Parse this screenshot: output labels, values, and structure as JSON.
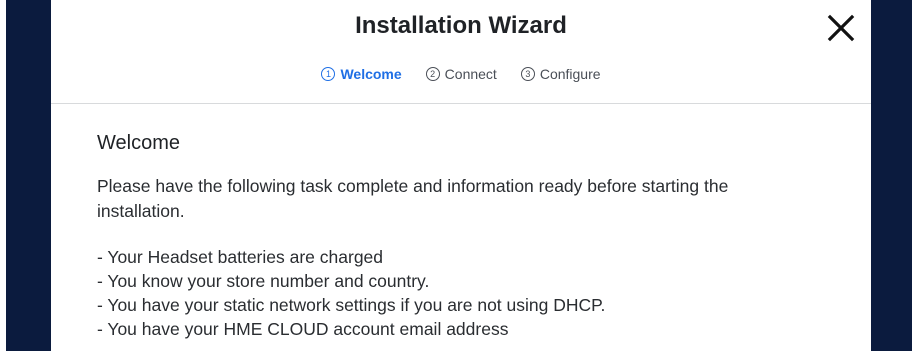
{
  "wizard": {
    "title": "Installation Wizard",
    "close_icon": "close-icon",
    "steps": [
      {
        "number": "1",
        "label": "Welcome",
        "active": true
      },
      {
        "number": "2",
        "label": "Connect",
        "active": false
      },
      {
        "number": "3",
        "label": "Configure",
        "active": false
      }
    ]
  },
  "content": {
    "heading": "Welcome",
    "intro": "Please have the following task complete and information ready before starting the installation.",
    "items": [
      "- Your Headset batteries are charged",
      "- You know your store number and country.",
      "- You have your static network settings if you are not using DHCP.",
      "- You have your HME CLOUD account email address"
    ]
  },
  "colors": {
    "accent": "#1f6fe5",
    "overlay": "#0b1b3e"
  }
}
